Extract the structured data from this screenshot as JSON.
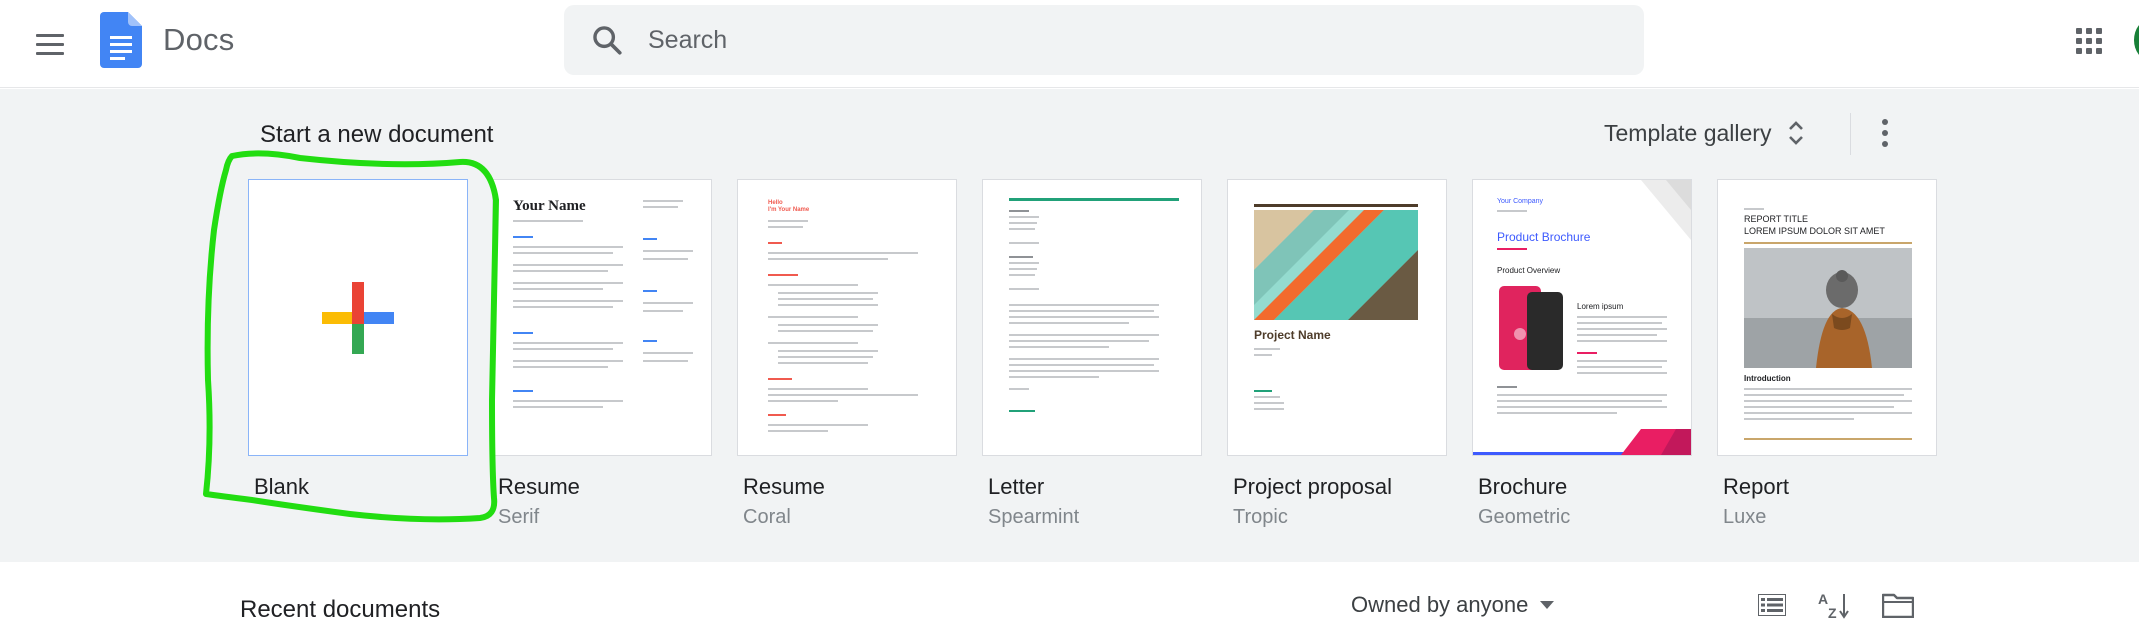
{
  "header": {
    "app_title": "Docs",
    "search_placeholder": "Search",
    "icons": {
      "menu": "hamburger-menu-icon",
      "logo": "docs-logo-icon",
      "search": "search-icon",
      "apps": "google-apps-icon"
    }
  },
  "templates_section": {
    "title": "Start a new document",
    "gallery_label": "Template gallery",
    "more_options_icon": "more-vert-icon",
    "templates": [
      {
        "name": "Blank",
        "subtitle": ""
      },
      {
        "name": "Resume",
        "subtitle": "Serif"
      },
      {
        "name": "Resume",
        "subtitle": "Coral"
      },
      {
        "name": "Letter",
        "subtitle": "Spearmint"
      },
      {
        "name": "Project proposal",
        "subtitle": "Tropic"
      },
      {
        "name": "Brochure",
        "subtitle": "Geometric"
      },
      {
        "name": "Report",
        "subtitle": "Luxe"
      }
    ],
    "thumb_text": {
      "serif_name": "Your Name",
      "coral_name": "Hello\nI'm Your Name",
      "proposal_title": "Project Name",
      "brochure_company": "Your Company",
      "brochure_title": "Product Brochure",
      "brochure_overview": "Product Overview",
      "brochure_lorem": "Lorem ipsum",
      "report_label": "REPORT TITLE",
      "report_sub": "LOREM IPSUM DOLOR SIT AMET",
      "report_intro": "Introduction"
    }
  },
  "recent_section": {
    "title": "Recent documents",
    "owner_filter": "Owned by anyone",
    "icons": {
      "list_view": "list-view-icon",
      "sort": "sort-az-icon",
      "folder": "folder-icon"
    }
  },
  "colors": {
    "annotation": "#22dd11",
    "brand_blue": "#4285f4",
    "accent_red": "#ea4335",
    "accent_yellow": "#fbbc04",
    "accent_green": "#34a853"
  }
}
